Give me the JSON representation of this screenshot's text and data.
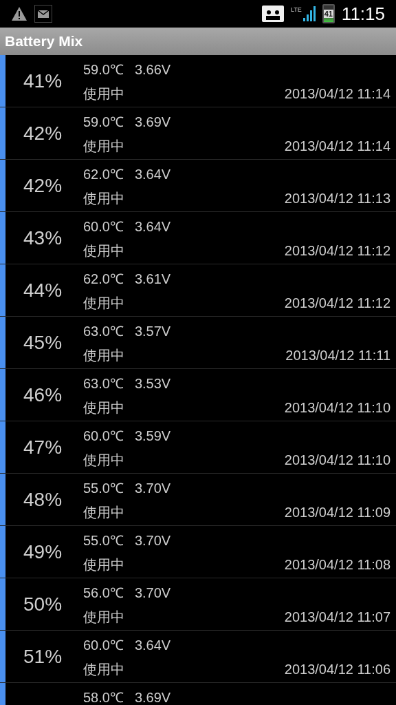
{
  "status_bar": {
    "network": "LTE",
    "battery": "41",
    "time": "11:15"
  },
  "title": "Battery Mix",
  "rows": [
    {
      "percent": "41%",
      "temperature": "59.0℃",
      "voltage": "3.66V",
      "status": "使用中",
      "timestamp": "2013/04/12 11:14"
    },
    {
      "percent": "42%",
      "temperature": "59.0℃",
      "voltage": "3.69V",
      "status": "使用中",
      "timestamp": "2013/04/12 11:14"
    },
    {
      "percent": "42%",
      "temperature": "62.0℃",
      "voltage": "3.64V",
      "status": "使用中",
      "timestamp": "2013/04/12 11:13"
    },
    {
      "percent": "43%",
      "temperature": "60.0℃",
      "voltage": "3.64V",
      "status": "使用中",
      "timestamp": "2013/04/12 11:12"
    },
    {
      "percent": "44%",
      "temperature": "62.0℃",
      "voltage": "3.61V",
      "status": "使用中",
      "timestamp": "2013/04/12 11:12"
    },
    {
      "percent": "45%",
      "temperature": "63.0℃",
      "voltage": "3.57V",
      "status": "使用中",
      "timestamp": "2013/04/12 11:11"
    },
    {
      "percent": "46%",
      "temperature": "63.0℃",
      "voltage": "3.53V",
      "status": "使用中",
      "timestamp": "2013/04/12 11:10"
    },
    {
      "percent": "47%",
      "temperature": "60.0℃",
      "voltage": "3.59V",
      "status": "使用中",
      "timestamp": "2013/04/12 11:10"
    },
    {
      "percent": "48%",
      "temperature": "55.0℃",
      "voltage": "3.70V",
      "status": "使用中",
      "timestamp": "2013/04/12 11:09"
    },
    {
      "percent": "49%",
      "temperature": "55.0℃",
      "voltage": "3.70V",
      "status": "使用中",
      "timestamp": "2013/04/12 11:08"
    },
    {
      "percent": "50%",
      "temperature": "56.0℃",
      "voltage": "3.70V",
      "status": "使用中",
      "timestamp": "2013/04/12 11:07"
    },
    {
      "percent": "51%",
      "temperature": "60.0℃",
      "voltage": "3.64V",
      "status": "使用中",
      "timestamp": "2013/04/12 11:06"
    },
    {
      "temperature": "58.0℃",
      "voltage": "3.69V"
    }
  ]
}
